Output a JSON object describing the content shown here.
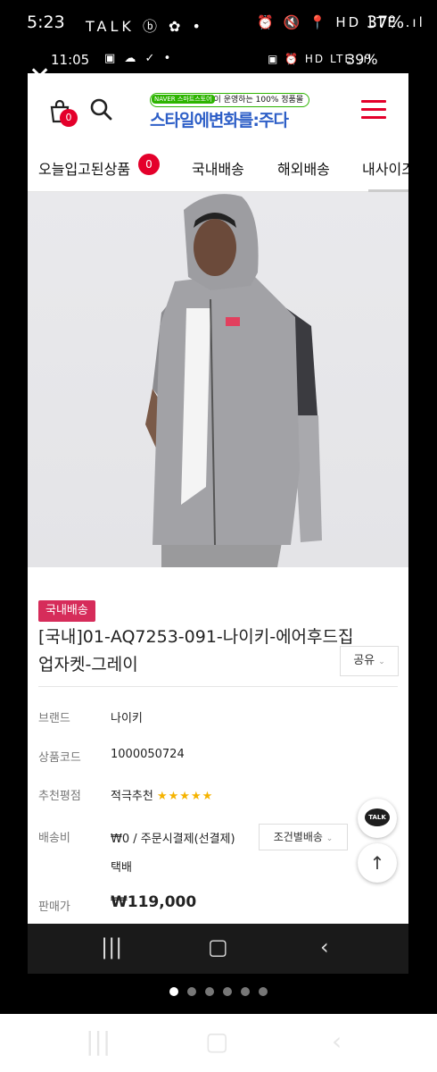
{
  "outer_status": {
    "time": "5:23",
    "left_icons": "TALK ⓑ ✿ •",
    "right_icons": "⏰ 🔇 📍 HD LTE .ıl",
    "battery": "37%"
  },
  "inner_status": {
    "time": "11:05",
    "left_icons": "▣ ☁ ✓ •",
    "right_icons": "▣ ⏰ HD LTE .ıl",
    "battery": "39%"
  },
  "header": {
    "cart_count": "0",
    "logo_badge": "NAVER 스마트스토어",
    "logo_tagline": "홍길이 운영하는 100% 정품몰",
    "logo_main": "스타일에변화를:주다"
  },
  "tabs": [
    {
      "label": "오늘입고된상품",
      "badge": "0"
    },
    {
      "label": "국내배송"
    },
    {
      "label": "해외배송"
    },
    {
      "label": "내사이즈"
    }
  ],
  "product": {
    "category_badge": "국내배송",
    "title": "[국내]01-AQ7253-091-나이키-에어후드집업자켓-그레이",
    "share_label": "공유",
    "specs": {
      "brand_label": "브랜드",
      "brand_value": "나이키",
      "code_label": "상품코드",
      "code_value": "1000050724",
      "rating_label": "추천평점",
      "rating_value": "적극추천",
      "rating_stars": "★★★★★",
      "shipping_label": "배송비",
      "shipping_value": "₩0 / 주문시결제(선결제)",
      "shipping_method": "택배",
      "shipping_condition": "조건별배송",
      "price_label": "판매가",
      "price_value": "₩119,000"
    }
  },
  "floating": {
    "talk_label": "TALK",
    "top_label": "↑"
  },
  "pager": {
    "count": 6,
    "active": 0
  }
}
